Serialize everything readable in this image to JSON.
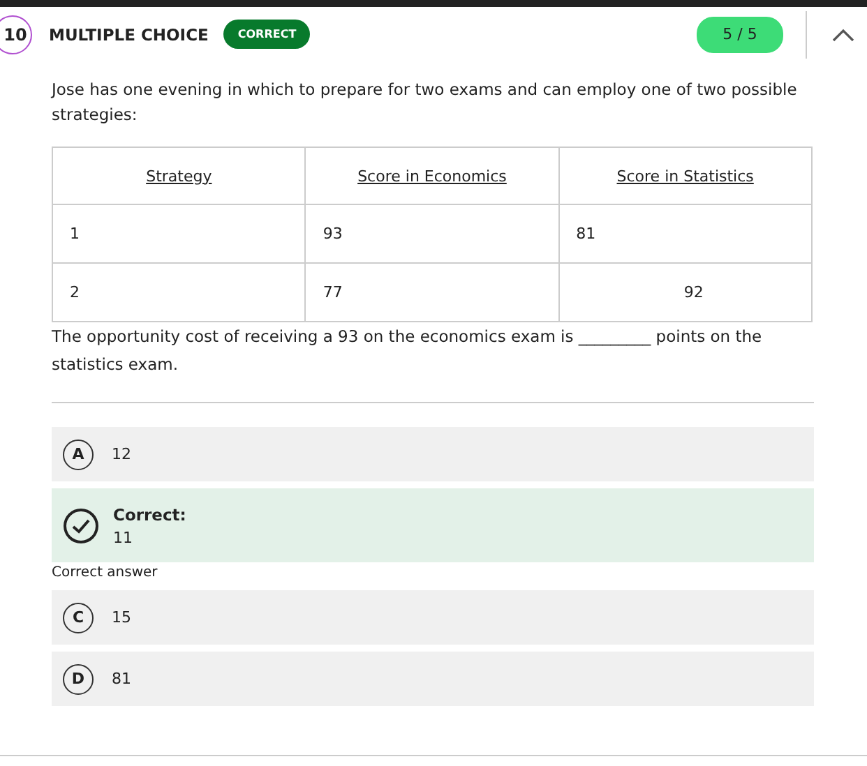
{
  "question": {
    "number": "10",
    "type": "MULTIPLE CHOICE",
    "status_badge": "CORRECT",
    "score": "5 / 5",
    "expanded": true
  },
  "prompt": "Jose has one evening in which to prepare for two exams and can employ one of two possible strategies:",
  "table": {
    "columns": [
      "Strategy",
      "Score in Economics",
      "Score in Statistics"
    ],
    "rows": [
      [
        {
          "text": "1"
        },
        {
          "text": "93"
        },
        {
          "text": "81"
        }
      ],
      [
        {
          "text": "2"
        },
        {
          "text": "77"
        },
        {
          "text": "92",
          "centered": true
        }
      ]
    ]
  },
  "question_text": "The opportunity cost of receiving a 93 on the economics exam is _________ points on the statistics exam.",
  "options": [
    {
      "kind": "option",
      "letter": "A",
      "value": "12"
    },
    {
      "kind": "correct",
      "label": "Correct:",
      "value": "11",
      "note": "Correct answer"
    },
    {
      "kind": "option",
      "letter": "C",
      "value": "15"
    },
    {
      "kind": "option",
      "letter": "D",
      "value": "81"
    }
  ]
}
